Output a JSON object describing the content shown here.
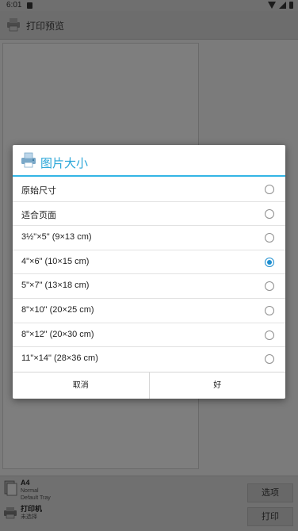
{
  "status_bar": {
    "time": "6:01"
  },
  "app_bar": {
    "title": "打印预览"
  },
  "bottom_bar": {
    "paper": {
      "size": "A4",
      "mode": "Normal",
      "tray": "Default Tray"
    },
    "printer": {
      "label": "打印机",
      "status": "未选择"
    },
    "options_label": "选项",
    "print_label": "打印"
  },
  "dialog": {
    "title": "图片大小",
    "options": [
      {
        "label": "原始尺寸",
        "selected": false
      },
      {
        "label": "适合页面",
        "selected": false
      },
      {
        "label": "3½\"×5\" (9×13 cm)",
        "selected": false
      },
      {
        "label": "4\"×6\" (10×15 cm)",
        "selected": true
      },
      {
        "label": "5\"×7\" (13×18 cm)",
        "selected": false
      },
      {
        "label": "8\"×10\" (20×25 cm)",
        "selected": false
      },
      {
        "label": "8\"×12\" (20×30 cm)",
        "selected": false
      },
      {
        "label": "11\"×14\" (28×36 cm)",
        "selected": false
      }
    ],
    "cancel_label": "取消",
    "ok_label": "好"
  },
  "colors": {
    "accent": "#33b5e5",
    "radio_checked": "#1f8fd0",
    "dim_background": "#7a7a7a"
  }
}
